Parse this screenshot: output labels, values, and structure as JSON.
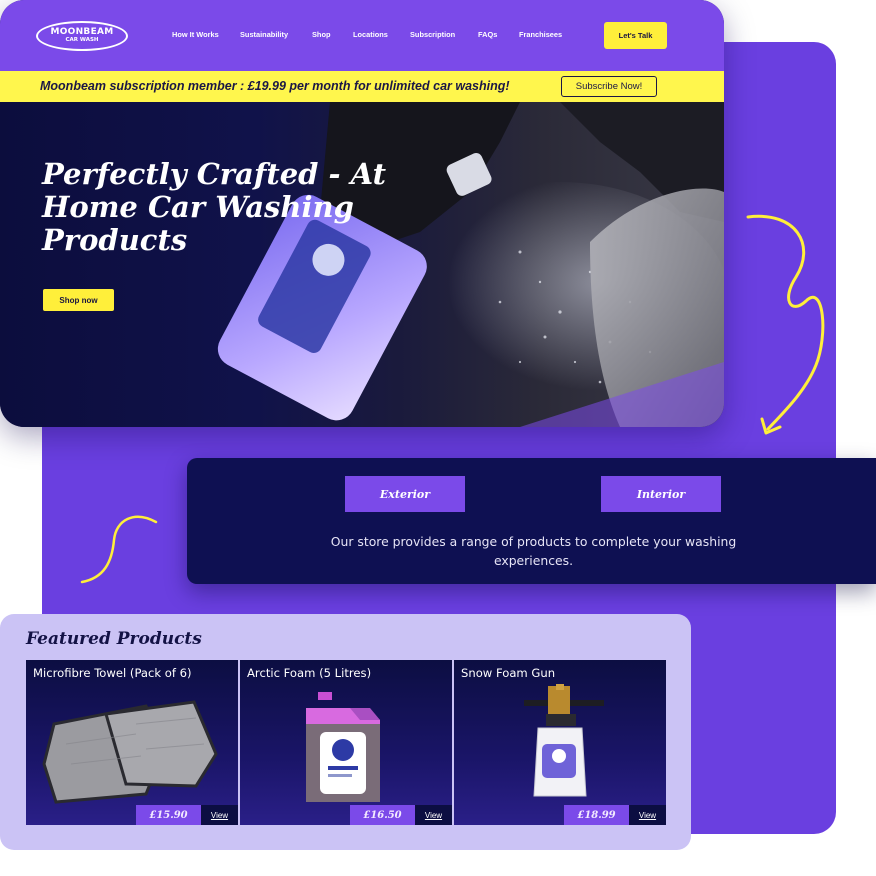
{
  "header": {
    "logo_line1": "MOONBEAM",
    "logo_line2": "CAR WASH",
    "nav": [
      "How It Works",
      "Sustainability",
      "Shop",
      "Locations",
      "Subscription",
      "FAQs",
      "Franchisees"
    ],
    "cta_label": "Let's Talk"
  },
  "promo": {
    "text": "Moonbeam subscription member : £19.99 per month for unlimited car washing!",
    "button_label": "Subscribe Now!"
  },
  "hero": {
    "title_lines": [
      "Perfectly Crafted - At",
      "Home Car Washing",
      "Products"
    ],
    "button_label": "Shop now"
  },
  "categories": {
    "exterior_label": "Exterior",
    "interior_label": "Interior",
    "description": "Our store provides a range of products to complete your washing experiences."
  },
  "featured": {
    "title": "Featured Products",
    "products": [
      {
        "name": "Microfibre Towel (Pack of 6)",
        "price": "£15.90",
        "link": "View"
      },
      {
        "name": "Arctic Foam (5 Litres)",
        "price": "£16.50",
        "link": "View"
      },
      {
        "name": "Snow Foam Gun",
        "price": "£18.99",
        "link": "View"
      }
    ]
  },
  "colors": {
    "purple": "#7b4ae9",
    "frame_purple": "#6a3fe0",
    "navy": "#0e1052",
    "yellow": "#fff64d",
    "lavender": "#cbc3f5"
  },
  "icons": [
    "squiggle-arrow-icon",
    "squiggle-icon"
  ]
}
